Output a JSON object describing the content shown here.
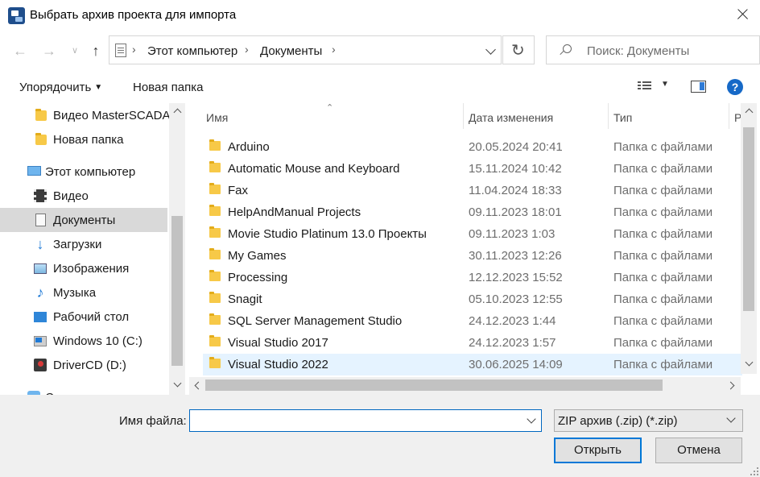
{
  "window": {
    "title": "Выбрать архив проекта для импорта"
  },
  "navigation": {
    "breadcrumb": [
      "Этот компьютер",
      "Документы"
    ],
    "search_placeholder": "Поиск: Документы"
  },
  "toolbar": {
    "organize_label": "Упорядочить",
    "new_folder_label": "Новая папка"
  },
  "sidebar": {
    "items": [
      {
        "label": "Видео MasterSCADA",
        "icon": "folder-icon"
      },
      {
        "label": "Новая папка",
        "icon": "folder-icon"
      },
      {
        "label": "Этот компьютер",
        "icon": "computer-icon"
      },
      {
        "label": "Видео",
        "icon": "video-icon"
      },
      {
        "label": "Документы",
        "icon": "documents-icon",
        "selected": true
      },
      {
        "label": "Загрузки",
        "icon": "downloads-icon"
      },
      {
        "label": "Изображения",
        "icon": "pictures-icon"
      },
      {
        "label": "Музыка",
        "icon": "music-icon"
      },
      {
        "label": "Рабочий стол",
        "icon": "desktop-icon"
      },
      {
        "label": "Windows 10 (C:)",
        "icon": "windows-drive-icon"
      },
      {
        "label": "DriverCD (D:)",
        "icon": "cd-drive-icon"
      },
      {
        "label": "С",
        "icon": "network-icon"
      }
    ]
  },
  "columns": {
    "name": "Имя",
    "date": "Дата изменения",
    "type": "Тип",
    "size": "Р"
  },
  "files": [
    {
      "name": "Arduino",
      "date": "20.05.2024 20:41",
      "type": "Папка с файлами"
    },
    {
      "name": "Automatic Mouse and Keyboard",
      "date": "15.11.2024 10:42",
      "type": "Папка с файлами"
    },
    {
      "name": "Fax",
      "date": "11.04.2024 18:33",
      "type": "Папка с файлами"
    },
    {
      "name": "HelpAndManual Projects",
      "date": "09.11.2023 18:01",
      "type": "Папка с файлами"
    },
    {
      "name": "Movie Studio Platinum 13.0 Проекты",
      "date": "09.11.2023 1:03",
      "type": "Папка с файлами"
    },
    {
      "name": "My Games",
      "date": "30.11.2023 12:26",
      "type": "Папка с файлами"
    },
    {
      "name": "Processing",
      "date": "12.12.2023 15:52",
      "type": "Папка с файлами"
    },
    {
      "name": "Snagit",
      "date": "05.10.2023 12:55",
      "type": "Папка с файлами"
    },
    {
      "name": "SQL Server Management Studio",
      "date": "24.12.2023 1:44",
      "type": "Папка с файлами"
    },
    {
      "name": "Visual Studio 2017",
      "date": "24.12.2023 1:57",
      "type": "Папка с файлами"
    },
    {
      "name": "Visual Studio 2022",
      "date": "30.06.2025 14:09",
      "type": "Папка с файлами",
      "hover": true
    }
  ],
  "footer": {
    "filename_label": "Имя файла:",
    "filename_value": "",
    "filter_selected": "ZIP архив (.zip) (*.zip)",
    "open_label": "Открыть",
    "cancel_label": "Отмена"
  },
  "colors": {
    "accent": "#0078d7",
    "selected_row": "#cce8ff",
    "hover_row": "#e5f3ff",
    "folder": "#f7c948"
  }
}
